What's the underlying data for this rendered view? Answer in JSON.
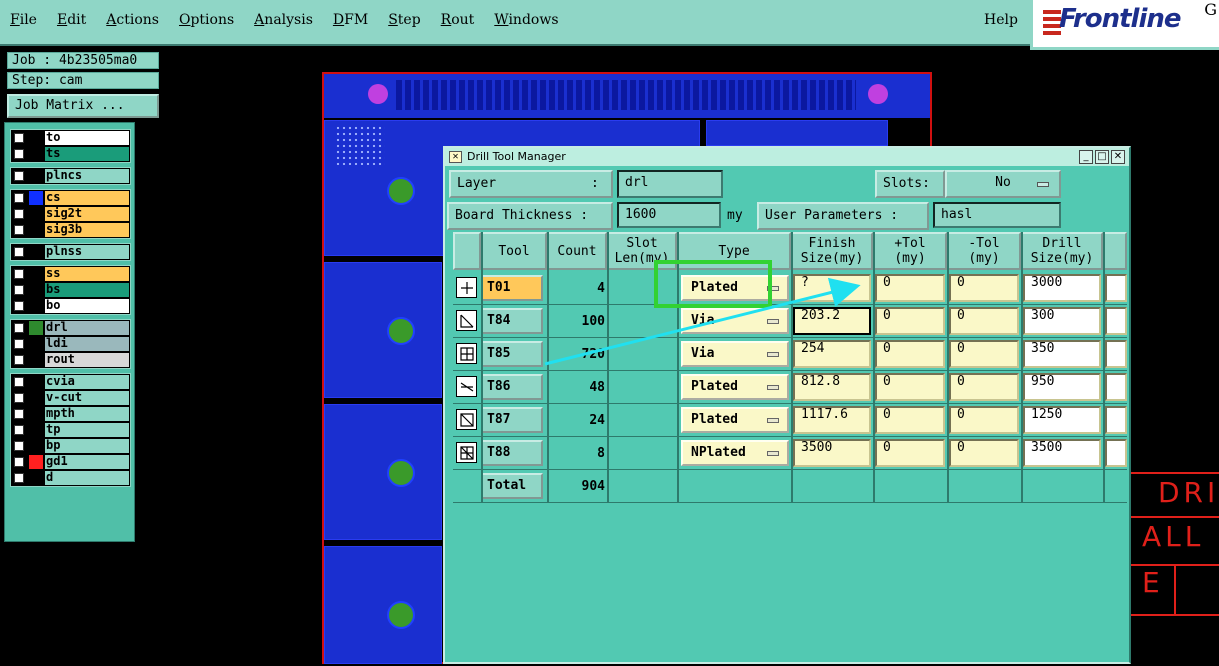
{
  "menu": {
    "items": [
      "File",
      "Edit",
      "Actions",
      "Options",
      "Analysis",
      "DFM",
      "Step",
      "Rout",
      "Windows"
    ],
    "help": "Help"
  },
  "logo": {
    "text": "Frontline",
    "suffix": "G"
  },
  "left_panel": {
    "job": "Job : 4b23505ma0",
    "step": "Step: cam",
    "job_matrix": "Job Matrix ..."
  },
  "layer_groups": [
    {
      "layers": [
        {
          "name": "to",
          "color": "#ffffff"
        },
        {
          "name": "ts",
          "color": "#1a9c7a"
        }
      ]
    },
    {
      "layers": [
        {
          "name": "plncs",
          "color": "#8fd6c6"
        }
      ]
    },
    {
      "layers": [
        {
          "name": "cs",
          "color": "#ffc85a",
          "swatch": "#1030ff"
        },
        {
          "name": "sig2t",
          "color": "#ffc85a"
        },
        {
          "name": "sig3b",
          "color": "#ffc85a"
        }
      ]
    },
    {
      "layers": [
        {
          "name": "plnss",
          "color": "#8fd6c6"
        }
      ]
    },
    {
      "layers": [
        {
          "name": "ss",
          "color": "#ffc85a"
        },
        {
          "name": "bs",
          "color": "#1a9c7a"
        },
        {
          "name": "bo",
          "color": "#ffffff"
        }
      ]
    },
    {
      "layers": [
        {
          "name": "drl",
          "color": "#9ab8bc",
          "swatch": "#2e8a2e"
        },
        {
          "name": "ldi",
          "color": "#9ab8bc"
        },
        {
          "name": "rout",
          "color": "#d8d8d8"
        }
      ]
    },
    {
      "layers": [
        {
          "name": "cvia",
          "color": "#8fd6c6"
        },
        {
          "name": "v-cut",
          "color": "#8fd6c6"
        },
        {
          "name": "mpth",
          "color": "#8fd6c6"
        },
        {
          "name": "tp",
          "color": "#8fd6c6"
        },
        {
          "name": "bp",
          "color": "#8fd6c6"
        },
        {
          "name": "gd1",
          "color": "#8fd6c6",
          "swatch": "#ff2020"
        },
        {
          "name": "d",
          "color": "#8fd6c6"
        }
      ]
    }
  ],
  "dtm": {
    "title": "Drill Tool Manager",
    "layer_label": "Layer",
    "layer_sep": ":",
    "layer_value": "drl",
    "slots_label": "Slots:",
    "slots_value": "No",
    "board_thickness_label": "Board Thickness :",
    "board_thickness_value": "1600",
    "board_thickness_unit": "my",
    "user_params_label": "User Parameters :",
    "user_params_value": "hasl",
    "columns": [
      "Tool",
      "Count",
      "Slot\nLen(my)",
      "Type",
      "Finish\nSize(my)",
      "+Tol\n(my)",
      "-Tol\n(my)",
      "Drill\nSize(my)"
    ],
    "rows": [
      {
        "tool": "T01",
        "count": "4",
        "type": "Plated",
        "finish": "?",
        "ptol": "0",
        "mtol": "0",
        "drill": "3000"
      },
      {
        "tool": "T84",
        "count": "100",
        "type": "Via",
        "finish": "203.2",
        "ptol": "0",
        "mtol": "0",
        "drill": "300"
      },
      {
        "tool": "T85",
        "count": "720",
        "type": "Via",
        "finish": "254",
        "ptol": "0",
        "mtol": "0",
        "drill": "350"
      },
      {
        "tool": "T86",
        "count": "48",
        "type": "Plated",
        "finish": "812.8",
        "ptol": "0",
        "mtol": "0",
        "drill": "950"
      },
      {
        "tool": "T87",
        "count": "24",
        "type": "Plated",
        "finish": "1117.6",
        "ptol": "0",
        "mtol": "0",
        "drill": "1250"
      },
      {
        "tool": "T88",
        "count": "8",
        "type": "NPlated",
        "finish": "3500",
        "ptol": "0",
        "mtol": "0",
        "drill": "3500"
      }
    ],
    "total_label": "Total",
    "total_count": "904"
  },
  "cad_text": [
    "DRI",
    "ALL",
    "E"
  ],
  "colors": {
    "panel": "#8fd6c6",
    "dialog": "#52c9b2",
    "pcb": "#1a2fd0",
    "highlight": "#32d232",
    "arrow": "#20e0f0"
  }
}
